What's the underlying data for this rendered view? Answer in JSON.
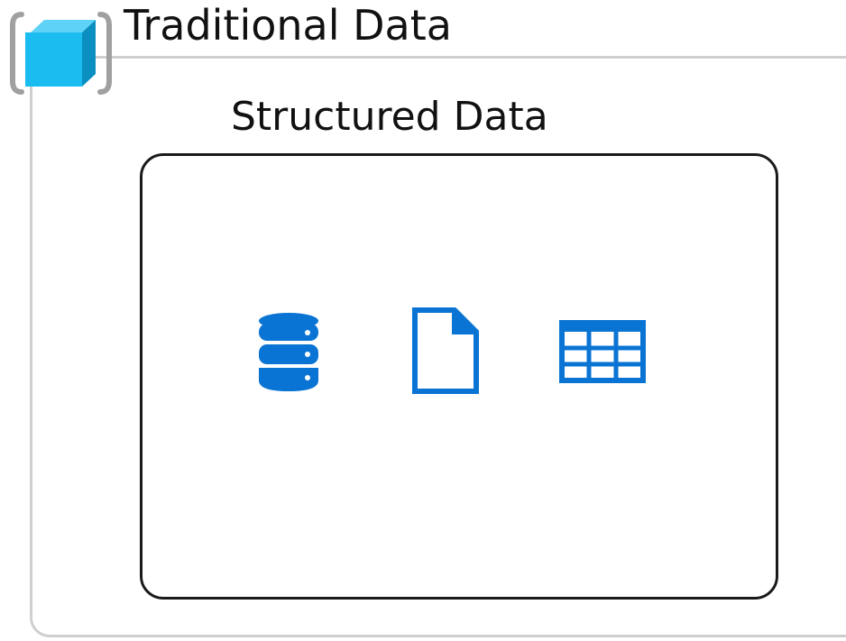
{
  "outer": {
    "title": "Traditional Data"
  },
  "inner": {
    "title": "Structured Data"
  },
  "icons": {
    "group": "cube-icon",
    "items": [
      "database-icon",
      "file-icon",
      "table-icon"
    ]
  },
  "colors": {
    "accent_blue": "#0a74d4",
    "cube_blue": "#1bbcf0",
    "bracket_gray": "#a0a0a0",
    "outer_border": "#cfcfcf",
    "inner_border": "#1a1a1a"
  }
}
